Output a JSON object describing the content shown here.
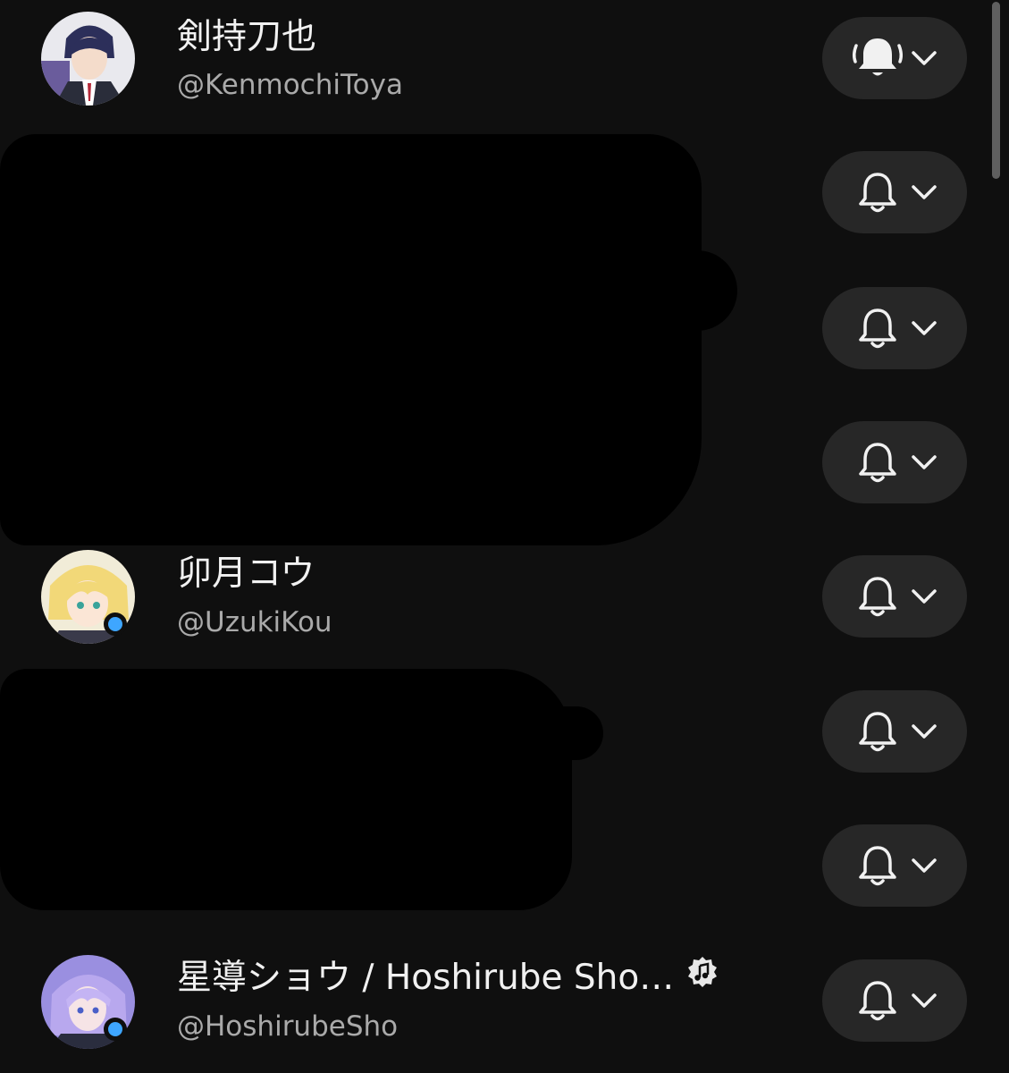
{
  "channels": [
    {
      "name": "剣持刀也",
      "handle": "@KenmochiToya",
      "notification": "all",
      "live": false,
      "verified": false
    },
    {
      "name": "",
      "handle": "",
      "notification": "personalized",
      "redacted": true
    },
    {
      "name": "",
      "handle": "",
      "notification": "personalized",
      "redacted": true
    },
    {
      "name": "",
      "handle": "",
      "notification": "personalized",
      "redacted": true
    },
    {
      "name": "卯月コウ",
      "handle": "@UzukiKou",
      "notification": "personalized",
      "live": true,
      "verified": false
    },
    {
      "name": "",
      "handle": "",
      "notification": "personalized",
      "redacted": true
    },
    {
      "name": "",
      "handle": "",
      "notification": "personalized",
      "redacted": true
    },
    {
      "name": "星導ショウ / Hoshirube Sho…",
      "handle": "@HoshirubeSho",
      "notification": "personalized",
      "live": true,
      "verified": true,
      "verified_icon": "music-note-badge-icon"
    }
  ],
  "icons": {
    "bell_all": "bell-ringing-icon",
    "bell": "bell-icon",
    "chevron": "chevron-down-icon"
  },
  "colors": {
    "background": "#0f0f0f",
    "button": "#272727",
    "live": "#3ea6ff",
    "text_primary": "#f1f1f1",
    "text_secondary": "#aaaaaa"
  }
}
